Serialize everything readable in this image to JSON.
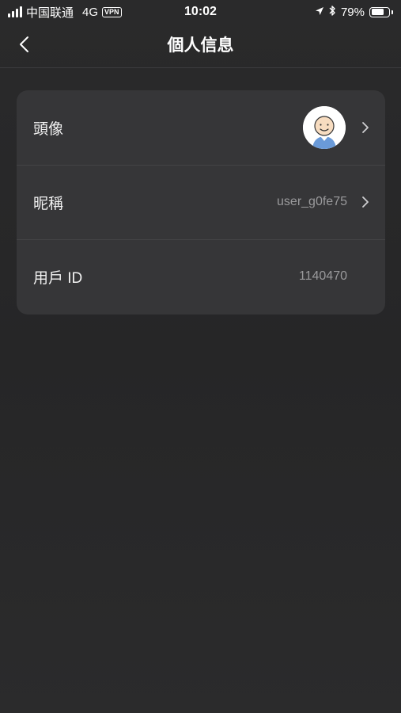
{
  "status_bar": {
    "carrier": "中国联通",
    "network": "4G",
    "vpn": "VPN",
    "time": "10:02",
    "battery_percent": "79%",
    "battery_level": 0.79
  },
  "nav": {
    "title": "個人信息"
  },
  "profile": {
    "rows": [
      {
        "label": "頭像",
        "value": ""
      },
      {
        "label": "昵稱",
        "value": "user_g0fe75"
      },
      {
        "label": "用戶 ID",
        "value": "1140470"
      }
    ]
  },
  "icons": {
    "back": "chevron-left-icon",
    "chevron": "chevron-right-icon",
    "location": "location-arrow-icon",
    "bluetooth": "bluetooth-icon",
    "battery": "battery-icon",
    "signal": "signal-icon",
    "avatar": "avatar-image"
  },
  "colors": {
    "background": "#282829",
    "card": "#363638",
    "value_text": "#9a9a9c",
    "avatar_shirt": "#6a9ad8",
    "avatar_face": "#f7dcc0"
  }
}
